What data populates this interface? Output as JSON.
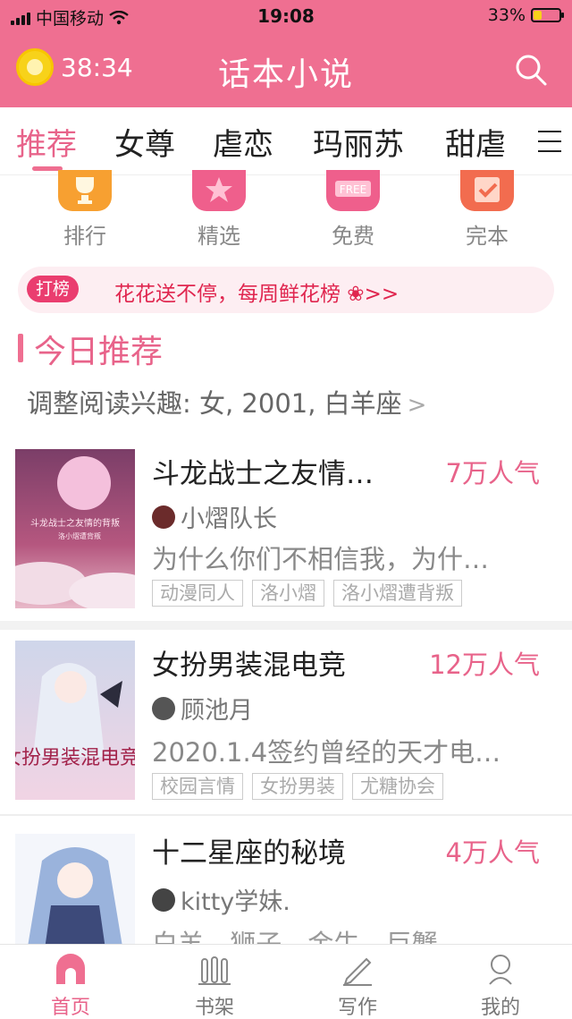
{
  "status": {
    "carrier": "中国移动",
    "time": "19:08",
    "battery": "33%",
    "battery_level": 0.33
  },
  "header": {
    "timer": "38:34",
    "title": "话本小说"
  },
  "tabs": [
    {
      "label": "推荐",
      "active": true
    },
    {
      "label": "女尊"
    },
    {
      "label": "虐恋"
    },
    {
      "label": "玛丽苏"
    },
    {
      "label": "甜虐"
    }
  ],
  "entries": [
    {
      "label": "排行",
      "icon": "trophy-icon"
    },
    {
      "label": "精选",
      "icon": "star-icon"
    },
    {
      "label": "免费",
      "icon": "free-icon",
      "badge": "FREE"
    },
    {
      "label": "完本",
      "icon": "check-icon"
    }
  ],
  "banner": {
    "tag": "打榜",
    "text": "花花送不停，每周鲜花榜 ❀>>"
  },
  "section": {
    "title": "今日推荐",
    "interest": "调整阅读兴趣: 女, 2001, 白羊座"
  },
  "books": [
    {
      "title": "斗龙战士之友情…",
      "popularity": "7万人气",
      "author": "小熠队长",
      "desc": "为什么你们不相信我，为什…",
      "tags": [
        "动漫同人",
        "洛小熠",
        "洛小熠遭背叛"
      ],
      "cover_text": "斗龙战士之友情的背叛",
      "cover_sub": "洛小熠遭背叛"
    },
    {
      "title": "女扮男装混电竞",
      "popularity": "12万人气",
      "author": "顾池月",
      "desc": "2020.1.4签约曾经的天才电…",
      "tags": [
        "校园言情",
        "女扮男装",
        "尤糖协会"
      ],
      "cover_text": "女扮男装混电竞"
    },
    {
      "title": "十二星座的秘境",
      "popularity": "4万人气",
      "author": "kitty学妹.",
      "desc": "白羊 狮子 金牛 巨蟹"
    }
  ],
  "tabbar": [
    {
      "label": "首页",
      "icon": "home-icon",
      "active": true
    },
    {
      "label": "书架",
      "icon": "bookshelf-icon"
    },
    {
      "label": "写作",
      "icon": "pen-icon"
    },
    {
      "label": "我的",
      "icon": "profile-icon"
    }
  ],
  "colors": {
    "brand": "#ef6f91",
    "accent": "#e8638a"
  }
}
